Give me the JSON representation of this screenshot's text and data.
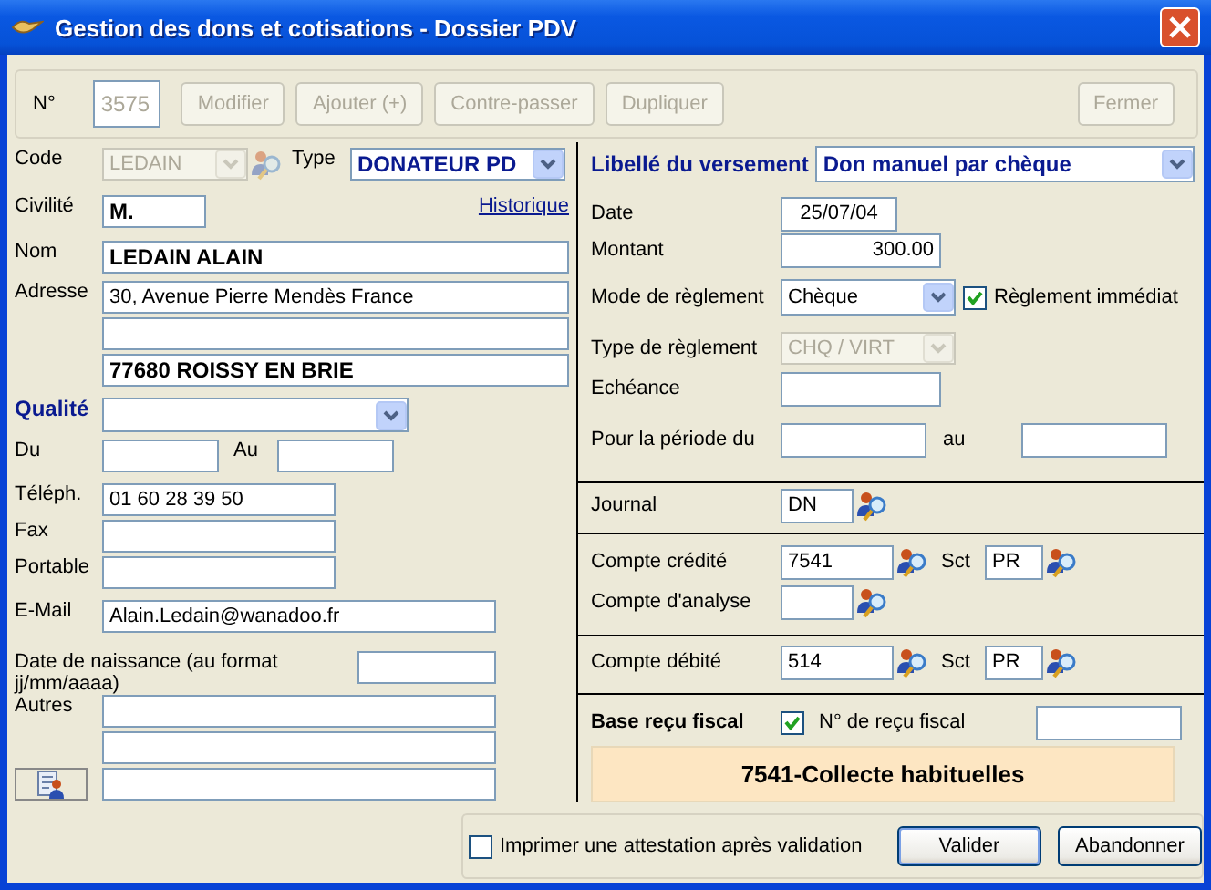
{
  "window": {
    "title": "Gestion des dons et cotisations - Dossier PDV"
  },
  "toolbar": {
    "number_label": "N°",
    "number": "3575",
    "buttons": [
      {
        "label": "Modifier",
        "disabled": true
      },
      {
        "label": "Ajouter (+)",
        "disabled": true
      },
      {
        "label": "Contre-passer",
        "disabled": true
      },
      {
        "label": "Dupliquer",
        "disabled": true
      },
      {
        "label": "Fermer",
        "disabled": true
      }
    ]
  },
  "donor": {
    "code": {
      "label": "Code",
      "value": "LEDAIN",
      "disabled": true
    },
    "type": {
      "label": "Type",
      "value": "DONATEUR PD"
    },
    "civilite": {
      "label": "Civilité",
      "value": "M."
    },
    "history_link": "Historique",
    "nom": {
      "label": "Nom",
      "value": "LEDAIN ALAIN"
    },
    "adresse": {
      "label": "Adresse",
      "line_1": "30, Avenue Pierre Mendès France",
      "line_3": "77680 ROISSY EN BRIE"
    },
    "qualite": {
      "label": "Qualité"
    },
    "du": {
      "label": "Du"
    },
    "au": {
      "label": "Au"
    },
    "telephone": {
      "label": "Téléph.",
      "value": "01 60 28 39 50"
    },
    "fax": {
      "label": "Fax"
    },
    "portable": {
      "label": "Portable"
    },
    "email": {
      "label": "E-Mail",
      "value": "Alain.Ledain@wanadoo.fr"
    },
    "naissance": {
      "label": "Date de naissance (au format jj/mm/aaaa)"
    },
    "autres": {
      "label": "Autres"
    }
  },
  "payment": {
    "libelle": {
      "label": "Libellé du versement",
      "value": "Don manuel par chèque"
    },
    "date": {
      "label": "Date",
      "value": "25/07/04"
    },
    "montant": {
      "label": "Montant",
      "value": "300.00"
    },
    "mode": {
      "label": "Mode de règlement",
      "value": "Chèque"
    },
    "immediat": {
      "label": "Règlement immédiat",
      "checked": true
    },
    "type_reglement": {
      "label": "Type de règlement",
      "value": "CHQ / VIRT",
      "disabled": true
    },
    "echeance": {
      "label": "Echéance"
    },
    "periode": {
      "label": "Pour la période du",
      "to_label": "au"
    },
    "journal": {
      "label": "Journal",
      "value": "DN"
    },
    "credit": {
      "label": "Compte crédité",
      "value": "7541",
      "sct_label": "Sct",
      "sct_value": "PR"
    },
    "analyse": {
      "label": "Compte d'analyse"
    },
    "debit": {
      "label": "Compte débité",
      "value": "514",
      "sct_label": "Sct",
      "sct_value": "PR"
    },
    "fiscal": {
      "label": "Base reçu fiscal",
      "checked": true,
      "receipt_label": "N° de reçu fiscal",
      "banner": "7541-Collecte habituelles"
    }
  },
  "footer": {
    "print": {
      "label": "Imprimer une attestation après validation",
      "checked": false
    },
    "buttons": [
      {
        "label": "Valider",
        "default": true
      },
      {
        "label": "Abandonner",
        "default": false
      }
    ]
  }
}
